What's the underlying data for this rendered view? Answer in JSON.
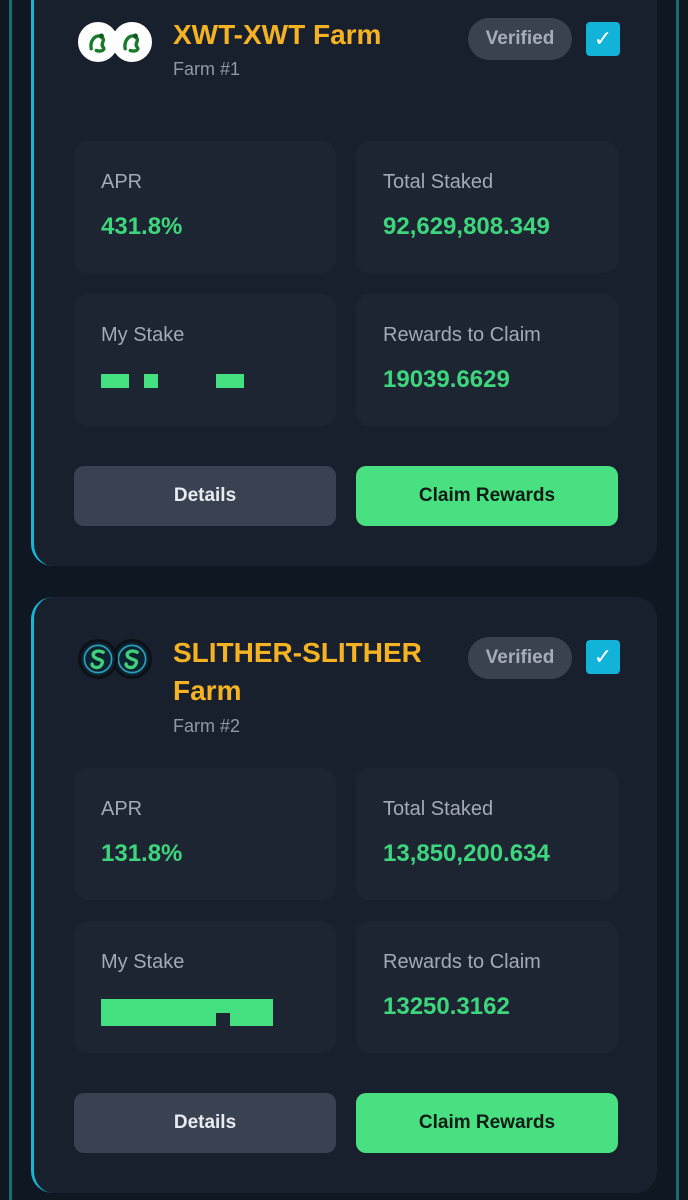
{
  "farms": [
    {
      "title": "XWT-XWT Farm",
      "subtitle": "Farm #1",
      "badge": "Verified",
      "checkbox_icon": "check-icon",
      "checkbox_glyph": "✓",
      "logo_icon": "green-dragon-token-icon",
      "stats": {
        "apr_label": "APR",
        "apr_value": "431.8%",
        "total_staked_label": "Total Staked",
        "total_staked_value": "92,629,808.349",
        "my_stake_label": "My Stake",
        "rewards_label": "Rewards to Claim",
        "rewards_value": "19039.6629"
      },
      "buttons": {
        "details": "Details",
        "claim": "Claim Rewards"
      }
    },
    {
      "title": "SLITHER-SLITHER Farm",
      "subtitle": "Farm #2",
      "badge": "Verified",
      "checkbox_icon": "check-icon",
      "checkbox_glyph": "✓",
      "logo_icon": "green-snake-token-icon",
      "stats": {
        "apr_label": "APR",
        "apr_value": "131.8%",
        "total_staked_label": "Total Staked",
        "total_staked_value": "13,850,200.634",
        "my_stake_label": "My Stake",
        "rewards_label": "Rewards to Claim",
        "rewards_value": "13250.3162"
      },
      "buttons": {
        "details": "Details",
        "claim": "Claim Rewards"
      }
    }
  ],
  "colors": {
    "background": "#0f1722",
    "card": "#18202d",
    "title_accent": "#f5b324",
    "value_green": "#3ed67d",
    "claim_button": "#48e080",
    "checkbox": "#12b3d8"
  }
}
